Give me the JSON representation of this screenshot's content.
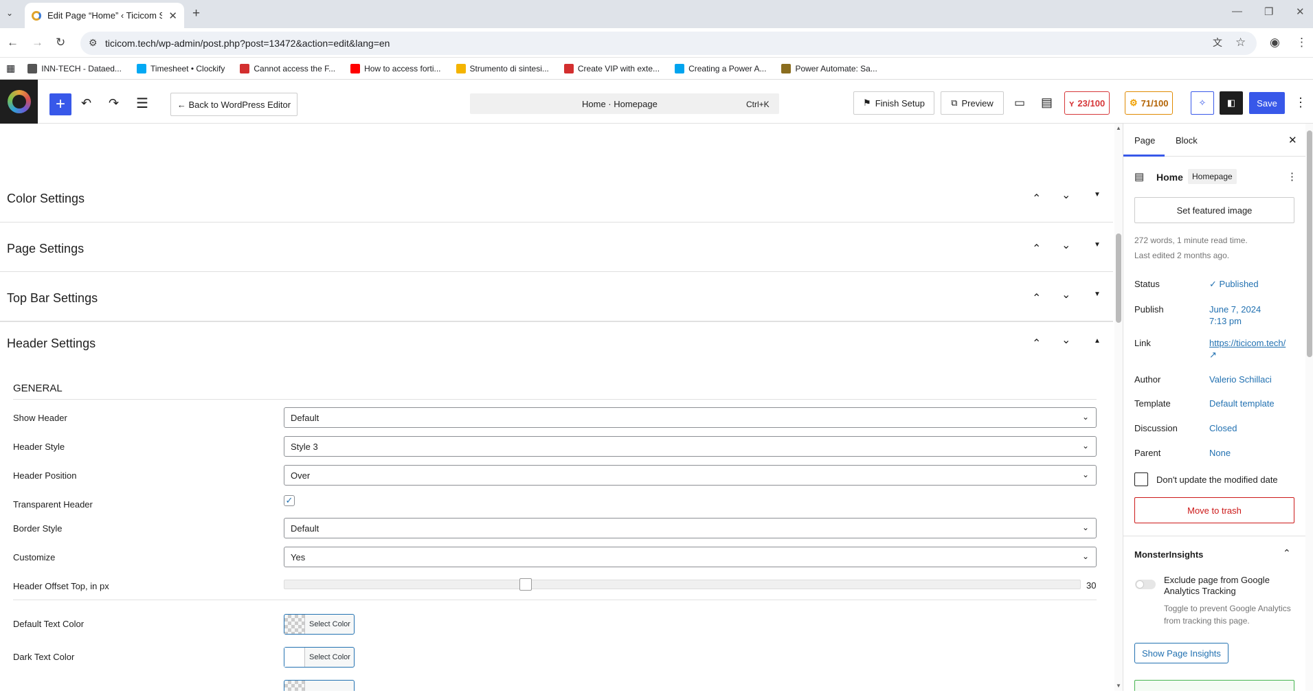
{
  "browser": {
    "tab_title": "Edit Page “Home” ‹ Ticicom SA",
    "url": "ticicom.tech/wp-admin/post.php?post=13472&action=edit&lang=en",
    "bookmarks": [
      {
        "label": "INN-TECH - Dataed...",
        "color": "#555555"
      },
      {
        "label": "Timesheet • Clockify",
        "color": "#03a9f4"
      },
      {
        "label": "Cannot access the F...",
        "color": "#d32f2f"
      },
      {
        "label": "How to access forti...",
        "color": "#ff0000"
      },
      {
        "label": "Strumento di sintesi...",
        "color": "#f4b400"
      },
      {
        "label": "Create VIP with exte...",
        "color": "#d32f2f"
      },
      {
        "label": "Creating a Power A...",
        "color": "#00a4ef"
      },
      {
        "label": "Power Automate: Sa...",
        "color": "#8a6d1f"
      }
    ]
  },
  "toolbar": {
    "back_label": "← Back to WordPress Editor",
    "command_title": "Home · Homepage",
    "command_shortcut": "Ctrl+K",
    "finish_setup": "Finish Setup",
    "preview": "Preview",
    "score_red": "23/100",
    "score_orange": "71/100",
    "save": "Save"
  },
  "sections": {
    "color": "Color Settings",
    "page": "Page Settings",
    "topbar": "Top Bar Settings",
    "header": "Header Settings"
  },
  "general": {
    "heading": "GENERAL",
    "show_header_label": "Show Header",
    "show_header_value": "Default",
    "header_style_label": "Header Style",
    "header_style_value": "Style 3",
    "header_position_label": "Header Position",
    "header_position_value": "Over",
    "transparent_label": "Transparent Header",
    "transparent_checked": true,
    "border_style_label": "Border Style",
    "border_style_value": "Default",
    "customize_label": "Customize",
    "customize_value": "Yes",
    "offset_label": "Header Offset Top, in px",
    "offset_value": "30",
    "offset_fraction": 0.3,
    "default_text_color_label": "Default Text Color",
    "dark_text_color_label": "Dark Text Color",
    "select_color": "Select Color"
  },
  "sidebar": {
    "tab_page": "Page",
    "tab_block": "Block",
    "title": "Home",
    "badge": "Homepage",
    "featured": "Set featured image",
    "words": "272 words, 1 minute read time.",
    "edited": "Last edited 2 months ago.",
    "status_label": "Status",
    "status_value": "Published",
    "publish_label": "Publish",
    "publish_date": "June 7, 2024",
    "publish_time": "7:13 pm",
    "link_label": "Link",
    "link_value": "https://ticicom.tech/",
    "link_arrow": "↗",
    "author_label": "Author",
    "author_value": "Valerio Schillaci",
    "template_label": "Template",
    "template_value": "Default template",
    "discussion_label": "Discussion",
    "discussion_value": "Closed",
    "parent_label": "Parent",
    "parent_value": "None",
    "modified_checkbox": "Don't update the modified date",
    "trash": "Move to trash",
    "mi_title": "MonsterInsights",
    "mi_exclude": "Exclude page from Google Analytics Tracking",
    "mi_toggle_help": "Toggle to prevent Google Analytics from tracking this page.",
    "mi_insights": "Show Page Insights"
  }
}
